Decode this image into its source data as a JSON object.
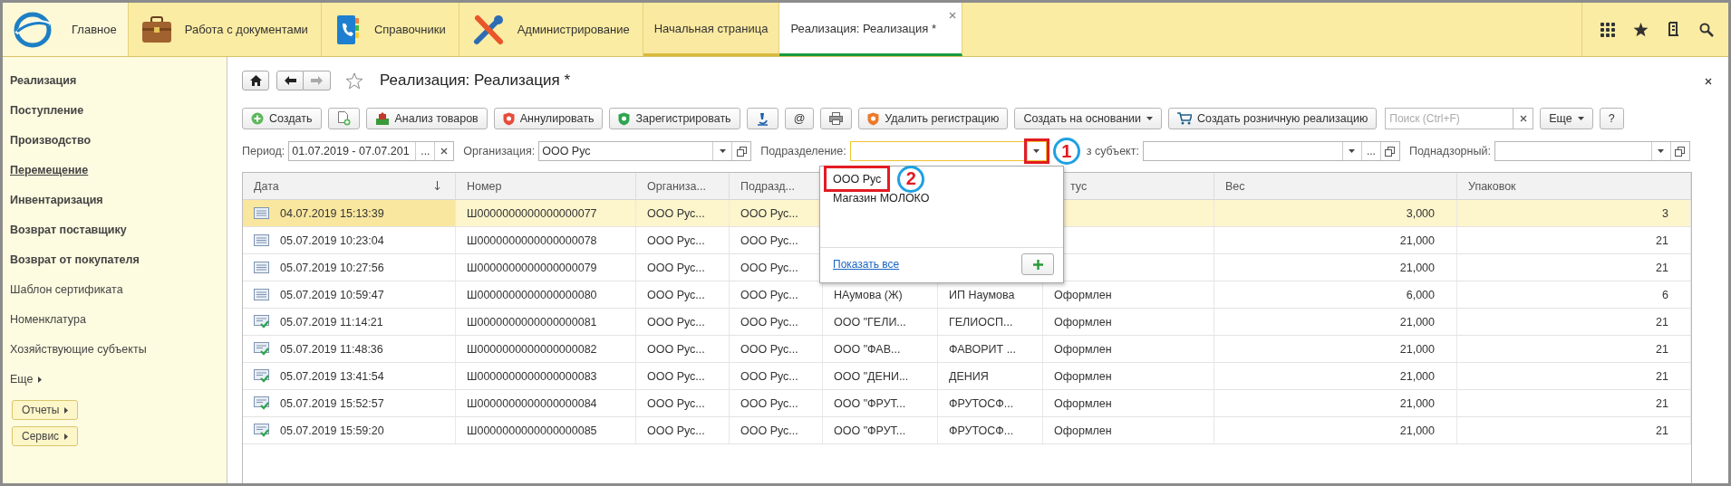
{
  "top_bar": {
    "sections": [
      {
        "label": "Главное",
        "kind": "logo",
        "selected": true
      },
      {
        "label": "Работа с документами",
        "kind": "briefcase",
        "selected": false
      },
      {
        "label": "Справочники",
        "kind": "phonebook",
        "selected": false
      },
      {
        "label": "Администрирование",
        "kind": "tools",
        "selected": false
      }
    ],
    "window_tabs": [
      {
        "label": "Начальная страница",
        "selected": false
      },
      {
        "label": "Реализация: Реализация *",
        "selected": true
      }
    ]
  },
  "sidebar": {
    "items": [
      {
        "label": "Реализация",
        "bold": true,
        "selected": false
      },
      {
        "label": "Поступление",
        "bold": true,
        "selected": false
      },
      {
        "label": "Производство",
        "bold": true,
        "selected": false
      },
      {
        "label": "Перемещение",
        "bold": true,
        "selected": true
      },
      {
        "label": "Инвентаризация",
        "bold": true,
        "selected": false
      },
      {
        "label": "Возврат поставщику",
        "bold": true,
        "selected": false
      },
      {
        "label": "Возврат от покупателя",
        "bold": true,
        "selected": false
      },
      {
        "label": "Шаблон сертификата",
        "bold": false,
        "selected": false
      },
      {
        "label": "Номенклатура",
        "bold": false,
        "selected": false
      },
      {
        "label": "Хозяйствующие субъекты",
        "bold": false,
        "selected": false
      }
    ],
    "more": "Еще",
    "buttons": [
      "Отчеты",
      "Сервис"
    ]
  },
  "form": {
    "title": "Реализация: Реализация *",
    "toolbar": [
      {
        "kind": "create",
        "label": "Создать"
      },
      {
        "kind": "copy"
      },
      {
        "kind": "analysis",
        "label": "Анализ товаров"
      },
      {
        "kind": "cancel",
        "label": "Аннулировать"
      },
      {
        "kind": "register",
        "label": "Зарегистрировать"
      },
      {
        "kind": "flask"
      },
      {
        "kind": "text",
        "label": "@"
      },
      {
        "kind": "print"
      },
      {
        "kind": "unregister",
        "label": "Удалить регистрацию"
      },
      {
        "kind": "menu",
        "label": "Создать на основании"
      },
      {
        "kind": "cart",
        "label": "Создать розничную реализацию"
      },
      {
        "kind": "search",
        "placeholder": "Поиск (Ctrl+F)"
      },
      {
        "kind": "menu",
        "label": "Еще"
      },
      {
        "kind": "text",
        "label": "?"
      }
    ],
    "filters": [
      {
        "kind": "period",
        "label": "Период:",
        "value": "01.07.2019 - 07.07.201",
        "choice_button": "...",
        "focused": false
      },
      {
        "kind": "select",
        "label": "Организация:",
        "value": "ООО Рус",
        "focused": false
      },
      {
        "kind": "dropdown",
        "label": "Подразделение:",
        "focused": true
      },
      {
        "kind": "choice",
        "label": "з субъект:",
        "choice_button": "...",
        "focused": false
      },
      {
        "kind": "select",
        "label": "Поднадзорный:",
        "focused": false
      }
    ],
    "popup": {
      "items": [
        "ООО Рус",
        "Магазин МОЛОКО"
      ],
      "show_all_link": "Показать все"
    },
    "annotations": [
      {
        "label": "1"
      },
      {
        "label": "2"
      }
    ],
    "table": {
      "columns": {
        "date": "Дата",
        "number": "Номер",
        "organization": "Организа...",
        "subdivision": "Подразд...",
        "status": "тус",
        "weight": "Вес",
        "packages": "Упаковок"
      },
      "rows": [
        {
          "kind": "document",
          "selected": true,
          "date": "04.07.2019 15:13:39",
          "number": "Ш0000000000000000077",
          "organization": "ООО Рус...",
          "subdivision": "ООО Рус...",
          "weight": "3,000",
          "packages": "3"
        },
        {
          "kind": "document",
          "selected": false,
          "date": "05.07.2019 10:23:04",
          "number": "Ш0000000000000000078",
          "organization": "ООО Рус...",
          "subdivision": "ООО Рус...",
          "weight": "21,000",
          "packages": "21"
        },
        {
          "kind": "document",
          "selected": false,
          "date": "05.07.2019 10:27:56",
          "number": "Ш0000000000000000079",
          "organization": "ООО Рус...",
          "subdivision": "ООО Рус...",
          "weight": "21,000",
          "packages": "21"
        },
        {
          "kind": "document",
          "selected": false,
          "date": "05.07.2019 10:59:47",
          "number": "Ш0000000000000000080",
          "organization": "ООО Рус...",
          "subdivision": "ООО Рус...",
          "column_5": "НАумова (Ж)",
          "column_6": "ИП Наумова",
          "status": "Оформлен",
          "weight": "6,000",
          "packages": "6"
        },
        {
          "kind": "posted",
          "selected": false,
          "date": "05.07.2019 11:14:21",
          "number": "Ш0000000000000000081",
          "organization": "ООО Рус...",
          "subdivision": "ООО Рус...",
          "column_5": "ООО \"ГЕЛИ...",
          "column_6": "ГЕЛИОСП...",
          "status": "Оформлен",
          "weight": "21,000",
          "packages": "21"
        },
        {
          "kind": "posted",
          "selected": false,
          "date": "05.07.2019 11:48:36",
          "number": "Ш0000000000000000082",
          "organization": "ООО Рус...",
          "subdivision": "ООО Рус...",
          "column_5": "ООО \"ФАВ...",
          "column_6": "ФАВОРИТ ...",
          "status": "Оформлен",
          "weight": "21,000",
          "packages": "21"
        },
        {
          "kind": "posted",
          "selected": false,
          "date": "05.07.2019 13:41:54",
          "number": "Ш0000000000000000083",
          "organization": "ООО Рус...",
          "subdivision": "ООО Рус...",
          "column_5": "ООО \"ДЕНИ...",
          "column_6": "ДЕНИЯ",
          "status": "Оформлен",
          "weight": "21,000",
          "packages": "21"
        },
        {
          "kind": "posted",
          "selected": false,
          "date": "05.07.2019 15:52:57",
          "number": "Ш0000000000000000084",
          "organization": "ООО Рус...",
          "subdivision": "ООО Рус...",
          "column_5": "ООО \"ФРУТ...",
          "column_6": "ФРУТОСФ...",
          "status": "Оформлен",
          "weight": "21,000",
          "packages": "21"
        },
        {
          "kind": "posted",
          "selected": false,
          "date": "05.07.2019 15:59:20",
          "number": "Ш0000000000000000085",
          "organization": "ООО Рус...",
          "subdivision": "ООО Рус...",
          "column_5": "ООО \"ФРУТ...",
          "column_6": "ФРУТОСФ...",
          "status": "Оформлен",
          "weight": "21,000",
          "packages": "21"
        }
      ]
    }
  }
}
